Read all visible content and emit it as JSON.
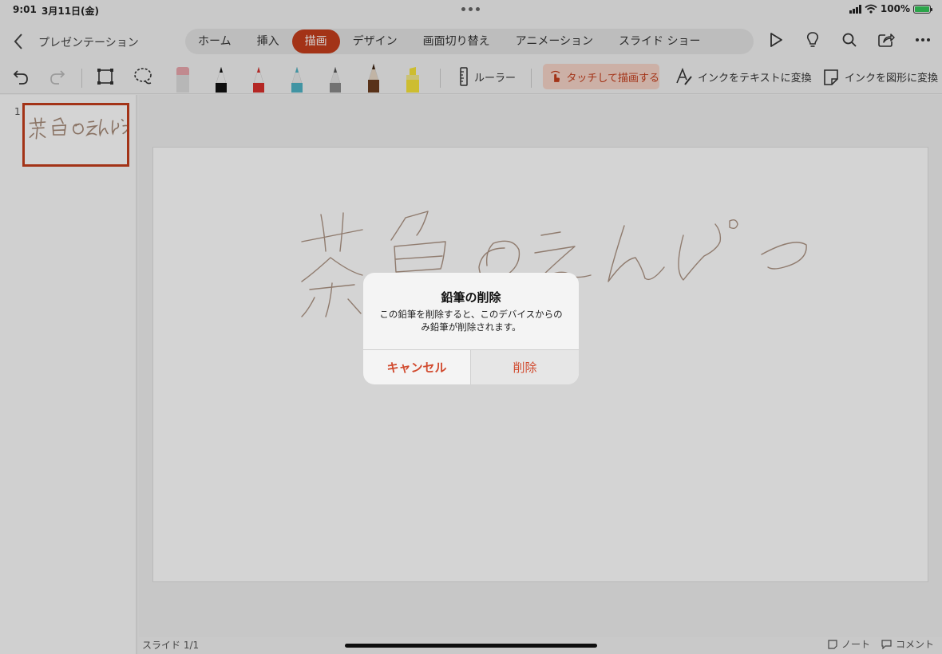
{
  "status": {
    "time": "9:01",
    "date": "3月11日(金)",
    "battery": "100%"
  },
  "header": {
    "title": "プレゼンテーション",
    "tabs": [
      {
        "label": "ホーム",
        "active": false
      },
      {
        "label": "挿入",
        "active": false
      },
      {
        "label": "描画",
        "active": true
      },
      {
        "label": "デザイン",
        "active": false
      },
      {
        "label": "画面切り替え",
        "active": false
      },
      {
        "label": "アニメーション",
        "active": false
      },
      {
        "label": "スライド ショー",
        "active": false
      }
    ],
    "icons": [
      "play-icon",
      "lightbulb-icon",
      "search-icon",
      "share-icon",
      "more-icon"
    ]
  },
  "toolbar": {
    "ruler_label": "ルーラー",
    "touch_draw_label": "タッチして描画する",
    "ink_to_text_label": "インクをテキストに変換",
    "ink_to_shape_label": "インクを図形に変換",
    "pens": [
      {
        "name": "eraser",
        "color": "#e9a7ad"
      },
      {
        "name": "pen-black",
        "color": "#111111"
      },
      {
        "name": "pen-red",
        "color": "#d9302c"
      },
      {
        "name": "pen-teal",
        "color": "#4fb3c4"
      },
      {
        "name": "pencil-gray",
        "color": "#8a8a8a"
      },
      {
        "name": "pencil-brown",
        "color": "#6b3d1f"
      },
      {
        "name": "highlighter-yellow",
        "color": "#f7e43a"
      }
    ]
  },
  "thumbnails": [
    {
      "number": "1"
    }
  ],
  "footer": {
    "slide_count": "スライド 1/1",
    "notes": "ノート",
    "comments": "コメント"
  },
  "dialog": {
    "title": "鉛筆の削除",
    "message": "この鉛筆を削除すると、このデバイスからのみ鉛筆が削除されます。",
    "cancel": "キャンセル",
    "delete": "削除"
  },
  "colors": {
    "accent": "#c43e1c",
    "ink": "#a58a78"
  }
}
